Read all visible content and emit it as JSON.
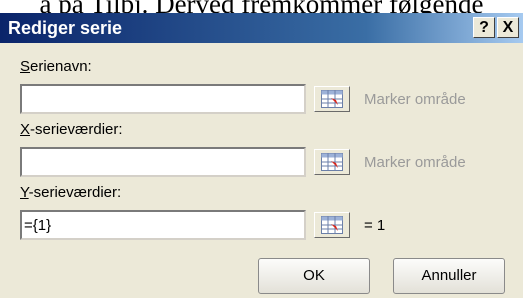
{
  "background_text": "ä på Tilbj. Derved fremkommer følgende",
  "dialog": {
    "title": "Rediger serie",
    "help_label": "?",
    "close_label": "X"
  },
  "fields": [
    {
      "label_accel": "S",
      "label_rest": "erienavn:",
      "value": "",
      "hint": "Marker område"
    },
    {
      "label_accel": "X",
      "label_rest": "-serieværdier:",
      "value": "",
      "hint": "Marker område"
    },
    {
      "label_accel": "Y",
      "label_rest": "-serieværdier:",
      "value": "={1}",
      "hint": "= 1"
    }
  ],
  "buttons": {
    "ok": "OK",
    "cancel": "Annuller"
  },
  "colors": {
    "dialog_bg": "#ece9d8",
    "title_bar_start": "#0a246a",
    "title_bar_end": "#a6caf0",
    "hint_gray": "#9a9a9a"
  },
  "icons": {
    "collapse": "range-collapse-icon"
  }
}
